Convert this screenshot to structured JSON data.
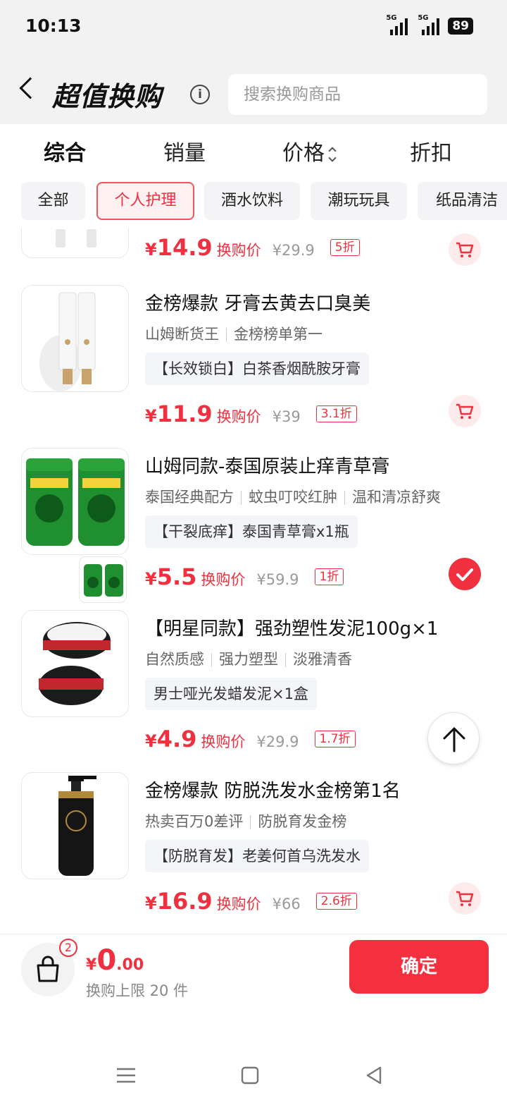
{
  "status": {
    "time": "10:13",
    "net1": "5G",
    "net2": "5G",
    "battery": "89"
  },
  "header": {
    "title": "超值换购",
    "search_placeholder": "搜索换购商品"
  },
  "sort_tabs": [
    {
      "label": "综合"
    },
    {
      "label": "销量"
    },
    {
      "label": "价格"
    },
    {
      "label": "折扣"
    }
  ],
  "chips": [
    {
      "label": "全部"
    },
    {
      "label": "个人护理"
    },
    {
      "label": "酒水饮料"
    },
    {
      "label": "潮玩玩具"
    },
    {
      "label": "纸品清洁"
    }
  ],
  "items": [
    {
      "title": "",
      "tags": [],
      "desc": "",
      "price_int": "14.9",
      "price_label": "换购价",
      "orig": "¥29.9",
      "discount": "5折",
      "state": "cart"
    },
    {
      "title": "金榜爆款 牙膏去黄去口臭美",
      "tags": [
        "山姆断货王",
        "金榜榜单第一"
      ],
      "desc": "【长效锁白】白茶香烟酰胺牙膏",
      "price_int": "11.9",
      "price_label": "换购价",
      "orig": "¥39",
      "discount": "3.1折",
      "state": "cart"
    },
    {
      "title": "山姆同款-泰国原装止痒青草膏",
      "tags": [
        "泰国经典配方",
        "蚊虫叮咬红肿",
        "温和清凉舒爽"
      ],
      "desc": "【干裂底痒】泰国青草膏x1瓶",
      "price_int": "5.5",
      "price_label": "换购价",
      "orig": "¥59.9",
      "discount": "1折",
      "state": "selected"
    },
    {
      "title": "【明星同款】强劲塑性发泥100g×1",
      "tags": [
        "自然质感",
        "强力塑型",
        "淡雅清香"
      ],
      "desc": "男士哑光发蜡发泥×1盒",
      "price_int": "4.9",
      "price_label": "换购价",
      "orig": "¥29.9",
      "discount": "1.7折",
      "state": "cart"
    },
    {
      "title": "金榜爆款 防脱洗发水金榜第1名",
      "tags": [
        "热卖百万0差评",
        "防脱育发金榜"
      ],
      "desc": "【防脱育发】老姜何首乌洗发水",
      "price_int": "16.9",
      "price_label": "换购价",
      "orig": "¥66",
      "discount": "2.6折",
      "state": "cart"
    }
  ],
  "currency": "¥",
  "bottom": {
    "badge": "2",
    "total_yen": "¥",
    "total_int": "0",
    "total_dec": ".00",
    "limit": "换购上限 20 件",
    "confirm": "确定"
  },
  "colors": {
    "accent": "#f0303e",
    "chip_active_bg": "#fff1f1",
    "bg_gray": "#f2f2f2"
  },
  "icons": [
    "back-chevron-icon",
    "info-icon",
    "cart-icon",
    "check-icon",
    "arrow-up-icon",
    "shopping-bag-icon",
    "menu-icon",
    "home-square-icon",
    "back-triangle-icon"
  ]
}
